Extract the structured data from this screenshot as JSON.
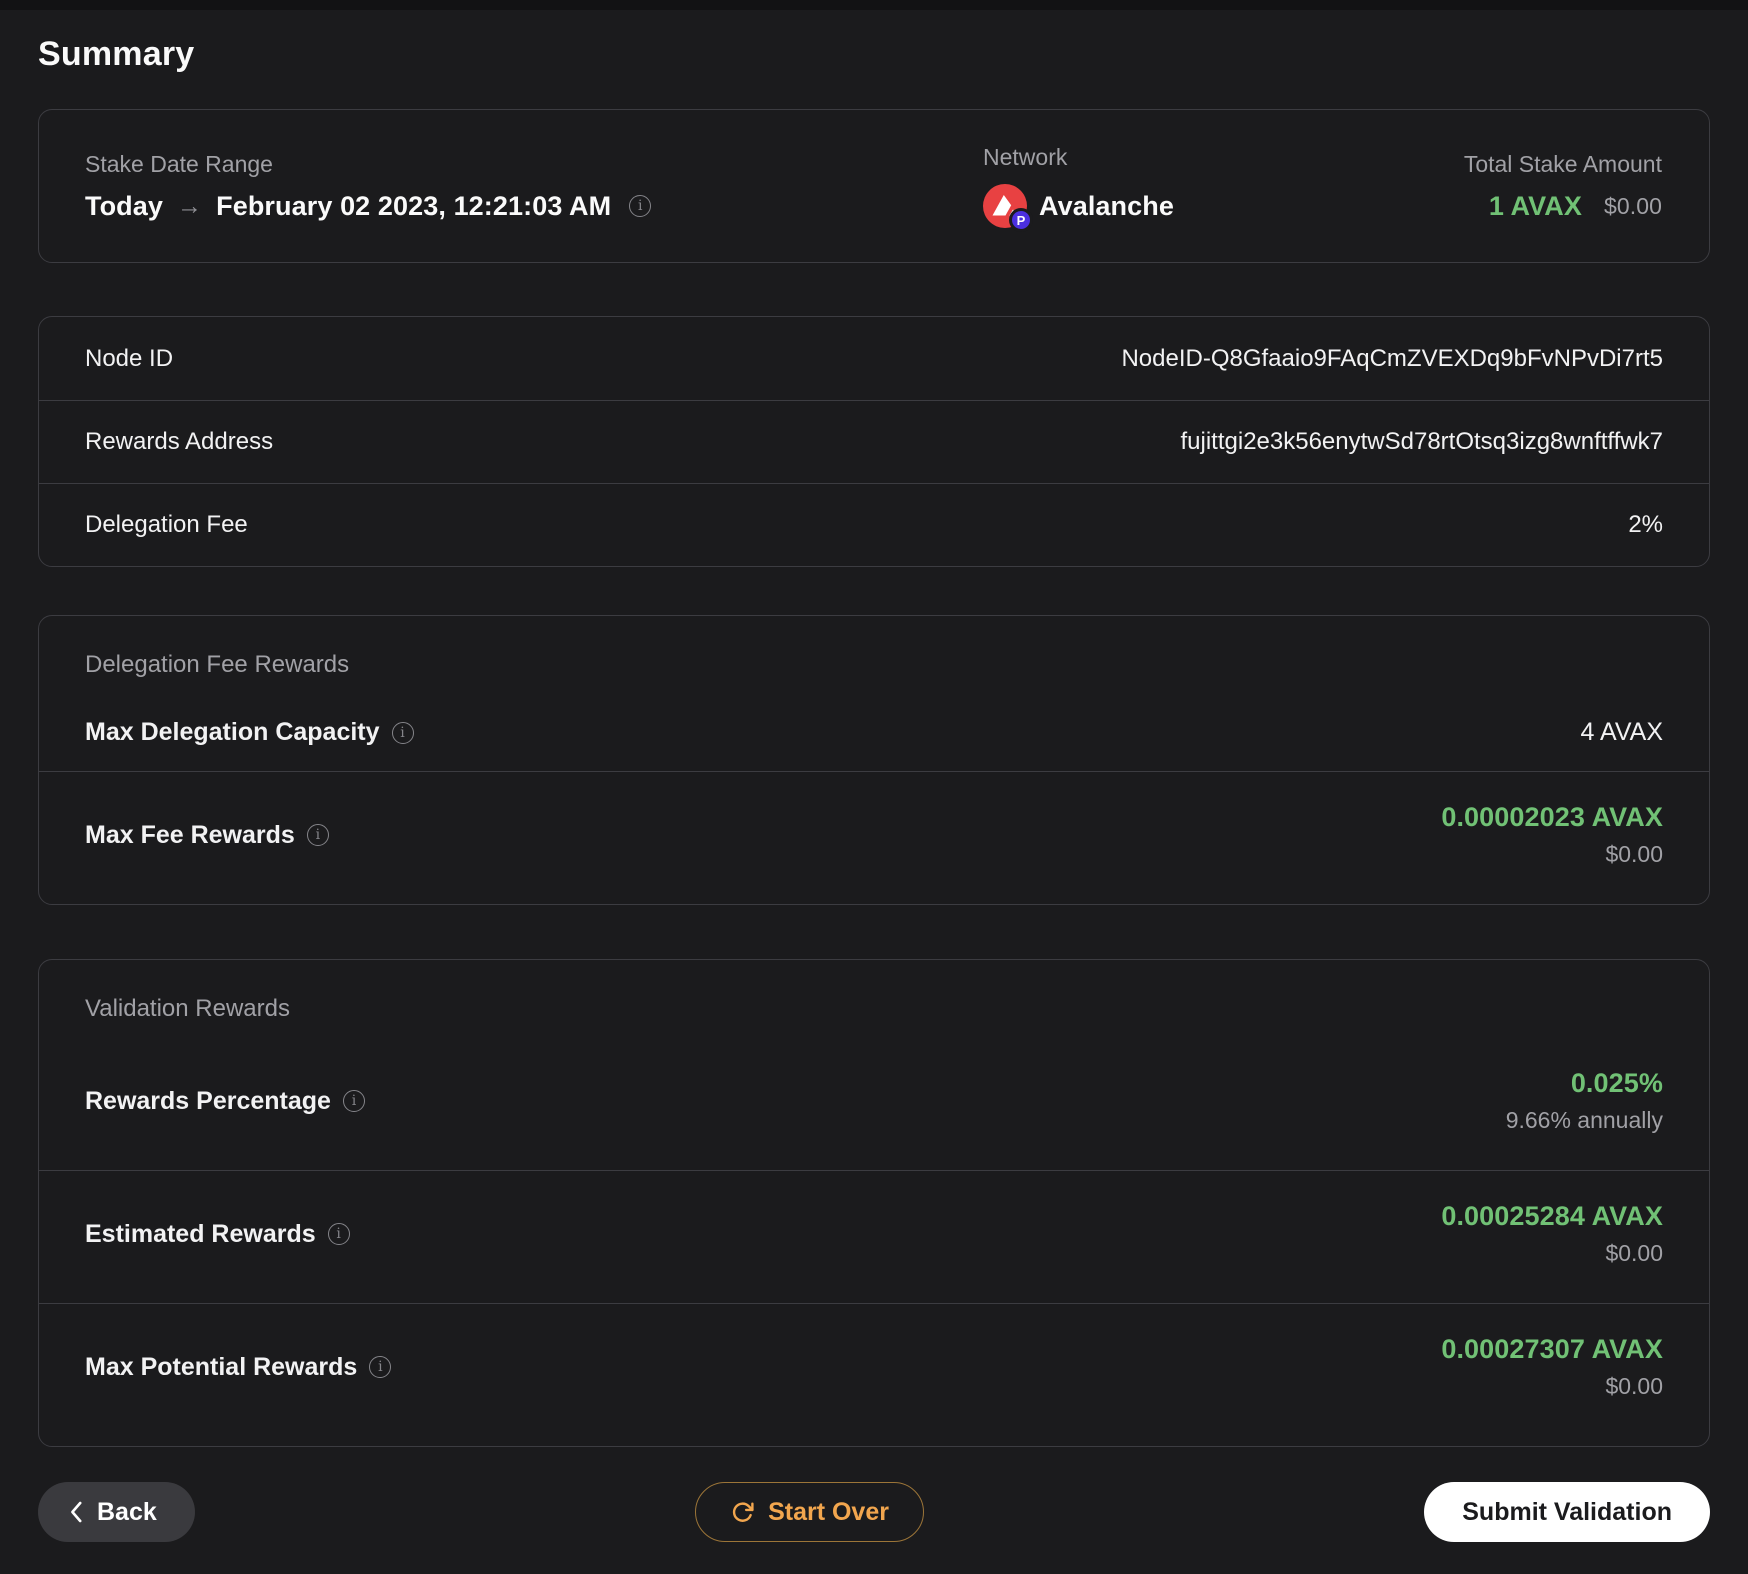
{
  "page": {
    "title": "Summary"
  },
  "overview": {
    "stake_date_range": {
      "label": "Stake Date Range",
      "from": "Today",
      "arrow": "→",
      "to": "February 02 2023, 12:21:03 AM"
    },
    "network": {
      "label": "Network",
      "value": "Avalanche",
      "chain_badge": "P"
    },
    "total_stake": {
      "label": "Total Stake Amount",
      "amount": "1 AVAX",
      "usd": "$0.00"
    }
  },
  "details_table": {
    "rows": [
      {
        "label": "Node ID",
        "value": "NodeID-Q8Gfaaio9FAqCmZVEXDq9bFvNPvDi7rt5"
      },
      {
        "label": "Rewards Address",
        "value": "fujittgi2e3k56enytwSd78rtOtsq3izg8wnftffwk7"
      },
      {
        "label": "Delegation Fee",
        "value": "2%"
      }
    ]
  },
  "delegation_fee_rewards": {
    "section_title": "Delegation Fee Rewards",
    "max_delegation_capacity": {
      "label": "Max Delegation Capacity",
      "value": "4 AVAX"
    },
    "max_fee_rewards": {
      "label": "Max Fee Rewards",
      "value": "0.00002023 AVAX",
      "usd": "$0.00"
    }
  },
  "validation_rewards": {
    "section_title": "Validation Rewards",
    "rewards_percentage": {
      "label": "Rewards Percentage",
      "value": "0.025%",
      "sub": "9.66% annually"
    },
    "estimated_rewards": {
      "label": "Estimated Rewards",
      "value": "0.00025284 AVAX",
      "usd": "$0.00"
    },
    "max_potential_rewards": {
      "label": "Max Potential Rewards",
      "value": "0.00027307 AVAX",
      "usd": "$0.00"
    }
  },
  "actions": {
    "back": "Back",
    "start_over": "Start Over",
    "submit": "Submit Validation"
  },
  "icons": {
    "arrow_right": "→",
    "info": "i",
    "chevron_left": "‹",
    "refresh": "↻"
  },
  "colors": {
    "accent_green": "#71c175",
    "accent_orange": "#f2a64e",
    "avalanche_red": "#e84142",
    "p_chain_purple": "#4b2fe0",
    "background": "#1b1b1d"
  }
}
